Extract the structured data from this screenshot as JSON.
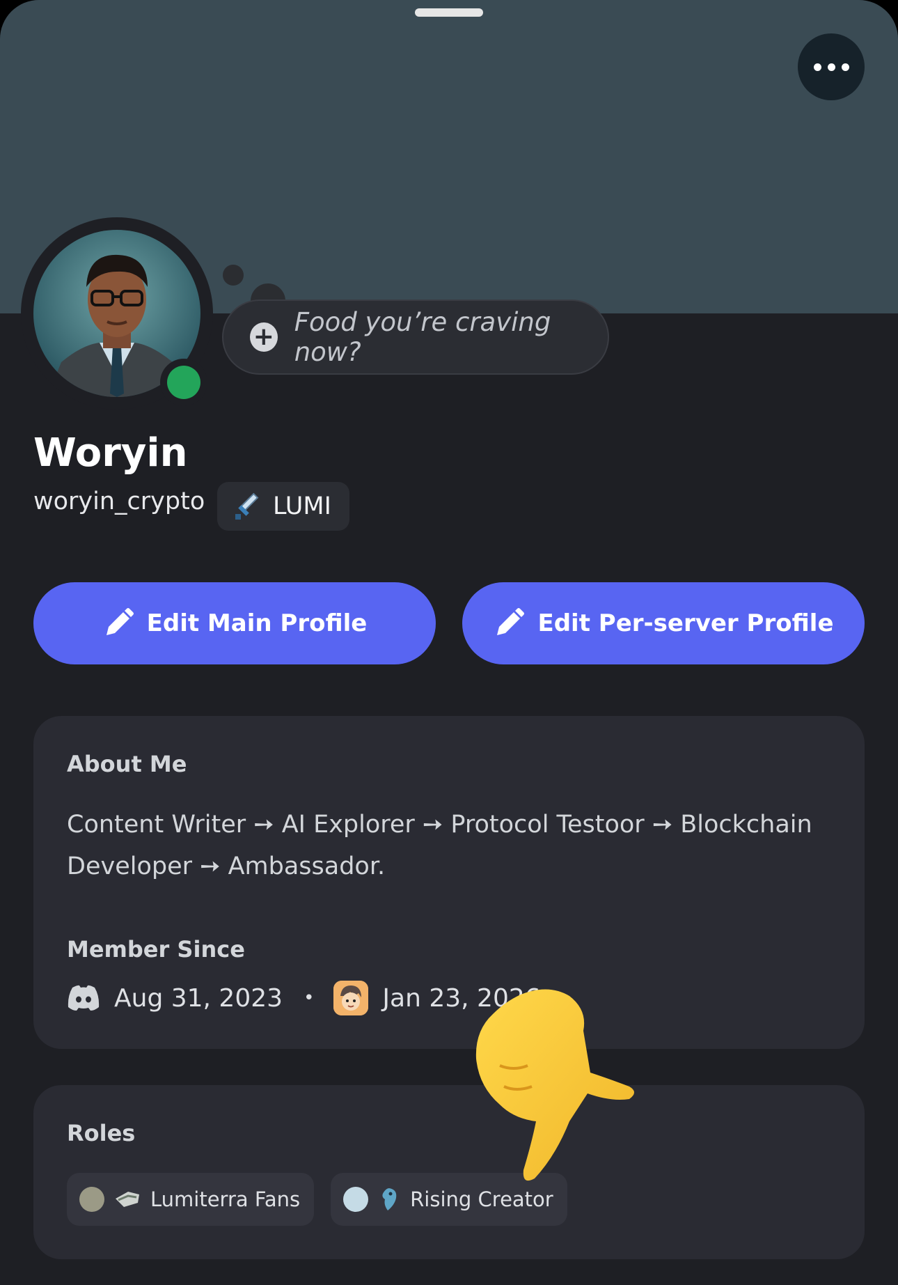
{
  "custom_status": {
    "placeholder": "Food you’re craving now?"
  },
  "profile": {
    "display_name": "Woryin",
    "username": "woryin_crypto",
    "tag": {
      "label": "LUMI",
      "icon": "sword-icon"
    },
    "status": "online"
  },
  "actions": {
    "edit_main": "Edit Main Profile",
    "edit_server": "Edit Per-server Profile"
  },
  "about": {
    "title": "About Me",
    "text": "Content Writer ➙ AI Explorer ➙ Protocol Testoor ➙ Blockchain Developer ➙ Ambassador."
  },
  "member_since": {
    "title": "Member Since",
    "discord_date": "Aug 31, 2023",
    "separator": "•",
    "server_date": "Jan 23, 2026"
  },
  "roles": {
    "title": "Roles",
    "items": [
      {
        "label": "Lumiterra Fans",
        "color": "#9b9a86",
        "icon": "pickaxe-icon"
      },
      {
        "label": "Rising Creator",
        "color": "#c5dbe6",
        "icon": "dragon-icon"
      }
    ]
  },
  "colors": {
    "accent": "#5865f2",
    "banner": "#3a4b54",
    "online": "#23a55a"
  }
}
